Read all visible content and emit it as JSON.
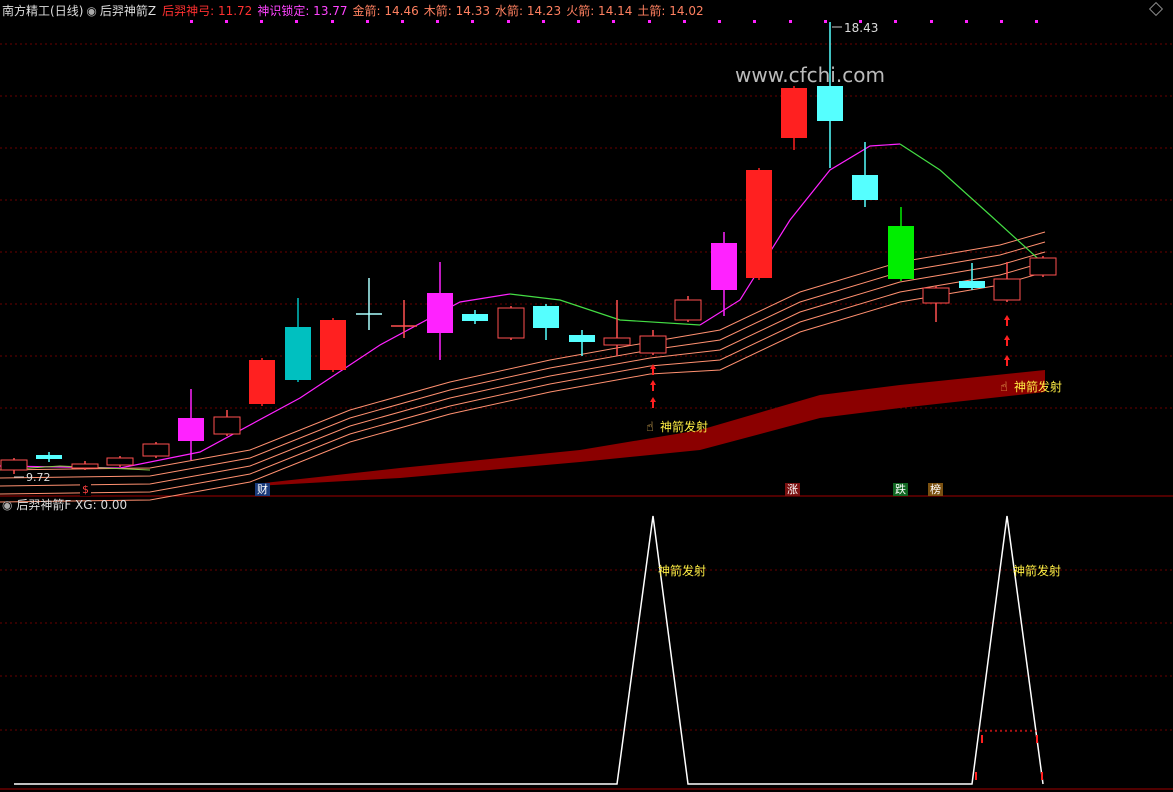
{
  "header": {
    "app_title": "南方精工",
    "period": "(日线)",
    "indicator_name": "后羿神箭Z",
    "values": [
      {
        "label": "后羿神弓:",
        "value": "11.72",
        "color": "#ff3030"
      },
      {
        "label": "神识锁定:",
        "value": "13.77",
        "color": "#ff44ff"
      },
      {
        "label": "金箭:",
        "value": "14.46",
        "color": "#ff8060"
      },
      {
        "label": "木箭:",
        "value": "14.33",
        "color": "#ff8060"
      },
      {
        "label": "水箭:",
        "value": "14.23",
        "color": "#ff8060"
      },
      {
        "label": "火箭:",
        "value": "14.14",
        "color": "#ff8060"
      },
      {
        "label": "土箭:",
        "value": "14.02",
        "color": "#ff8060"
      }
    ]
  },
  "main_chart": {
    "high_label": "18.43",
    "low_label": "9.72",
    "watermark": "www.cfchi.com",
    "signal_label": "神箭发射",
    "markers": [
      {
        "text": "$",
        "bg": "#000",
        "fg": "#ff4040"
      },
      {
        "text": "财",
        "bg": "#1a3a7a",
        "fg": "#ffffff"
      },
      {
        "text": "涨",
        "bg": "#7a1010",
        "fg": "#ffffff"
      },
      {
        "text": "跌",
        "bg": "#116622",
        "fg": "#ffffff"
      },
      {
        "text": "榜",
        "bg": "#7a5010",
        "fg": "#ffffff"
      }
    ],
    "colors": {
      "up": "#ff2020",
      "down_cyan": "#55ffff",
      "magenta": "#ff22ff",
      "teal": "#00c0c0",
      "green": "#00ee00",
      "band": "#8b0000",
      "ma_lines": "#ff9070",
      "long_ma_magenta": "#ff22ff",
      "long_ma_green": "#44dd44"
    }
  },
  "sub_chart": {
    "indicator_name": "后羿神箭F",
    "xg_label": "XG:",
    "xg_value": "0.00",
    "signal_label": "神箭发射"
  }
}
